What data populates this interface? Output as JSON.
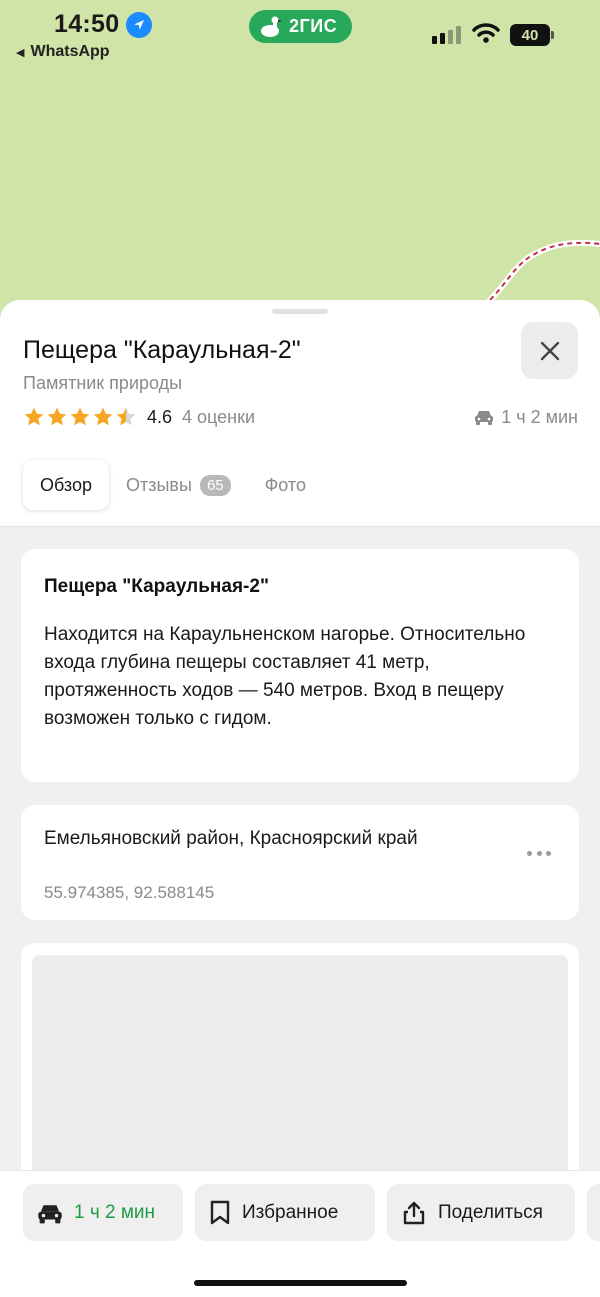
{
  "status_bar": {
    "time": "14:50",
    "back_app": "WhatsApp",
    "app_badge": "2ГИС",
    "battery": "40"
  },
  "place": {
    "title": "Пещера \"Караульная-2\"",
    "category": "Памятник природы",
    "rating": 4.6,
    "rating_text": "4.6",
    "rating_stars": 4.5,
    "rating_count": "4 оценки",
    "travel_time": "1 ч 2 мин"
  },
  "tabs": [
    {
      "label": "Обзор",
      "active": true
    },
    {
      "label": "Отзывы",
      "badge": "65"
    },
    {
      "label": "Фото"
    }
  ],
  "description": {
    "heading": "Пещера \"Караульная-2\"",
    "text": "Находится на Караульненском нагорье. Относительно входа глубина пещеры составляет 41 метр, протяженность ходов — 540 метров. Вход в пещеру возможен только с гидом."
  },
  "address": {
    "line": "Емельяновский район, Красноярский край",
    "coordinates": "55.974385, 92.588145"
  },
  "actions": {
    "route": "1 ч 2 мин",
    "favorite": "Избранное",
    "share": "Поделиться"
  },
  "icons": {
    "location": "location-arrow-icon",
    "close": "close-icon",
    "car": "car-icon",
    "bookmark": "bookmark-icon",
    "share": "share-icon",
    "more": "more-dots-icon"
  },
  "colors": {
    "map_bg": "#cfe4a6",
    "brand_green": "#27a85a",
    "route_green": "#1f9d43",
    "star": "#f5a623",
    "location_blue": "#1a8cff"
  }
}
